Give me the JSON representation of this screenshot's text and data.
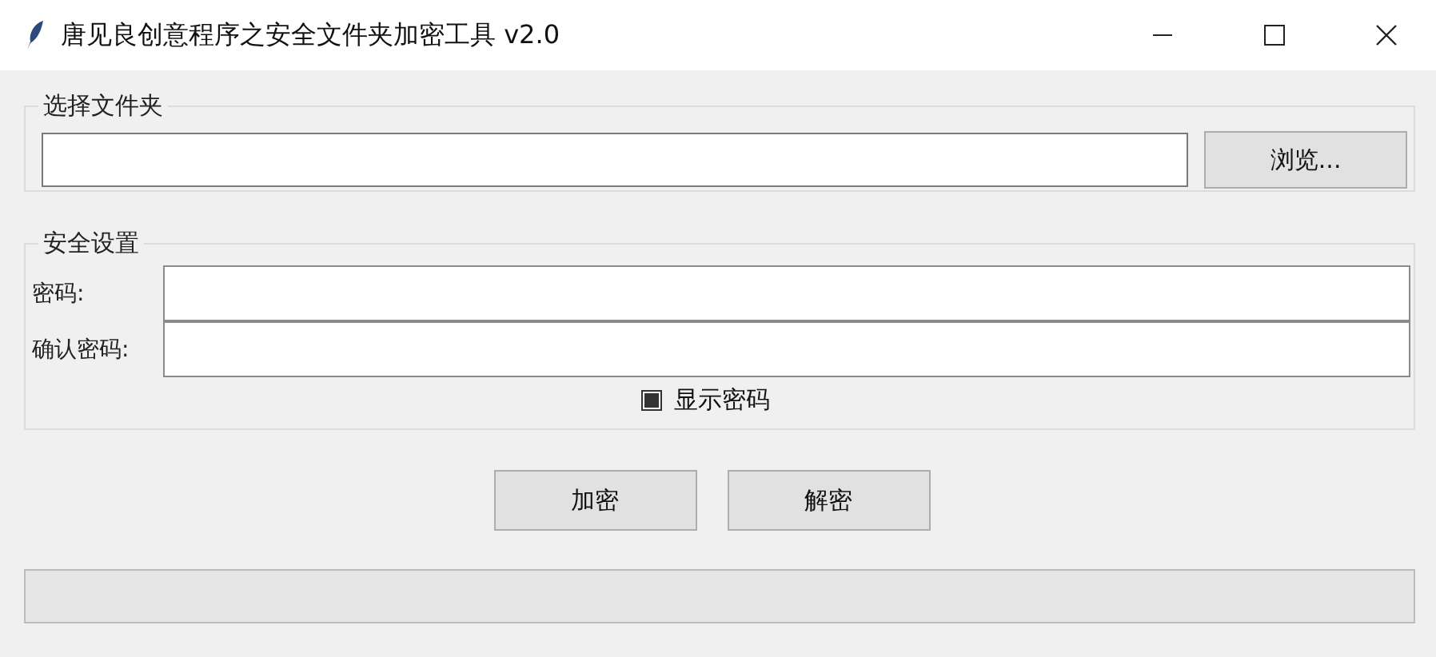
{
  "window": {
    "title": "唐见良创意程序之安全文件夹加密工具 v2.0"
  },
  "folder_group": {
    "title": "选择文件夹",
    "browse_button": "浏览..."
  },
  "security_group": {
    "title": "安全设置",
    "fields": [
      {
        "label": "密码:"
      },
      {
        "label": "确认密码:"
      }
    ],
    "show_password": {
      "label": "显示密码",
      "checked": true
    }
  },
  "buttons": [
    "加密",
    "解密"
  ],
  "progress": {
    "level": 0
  }
}
